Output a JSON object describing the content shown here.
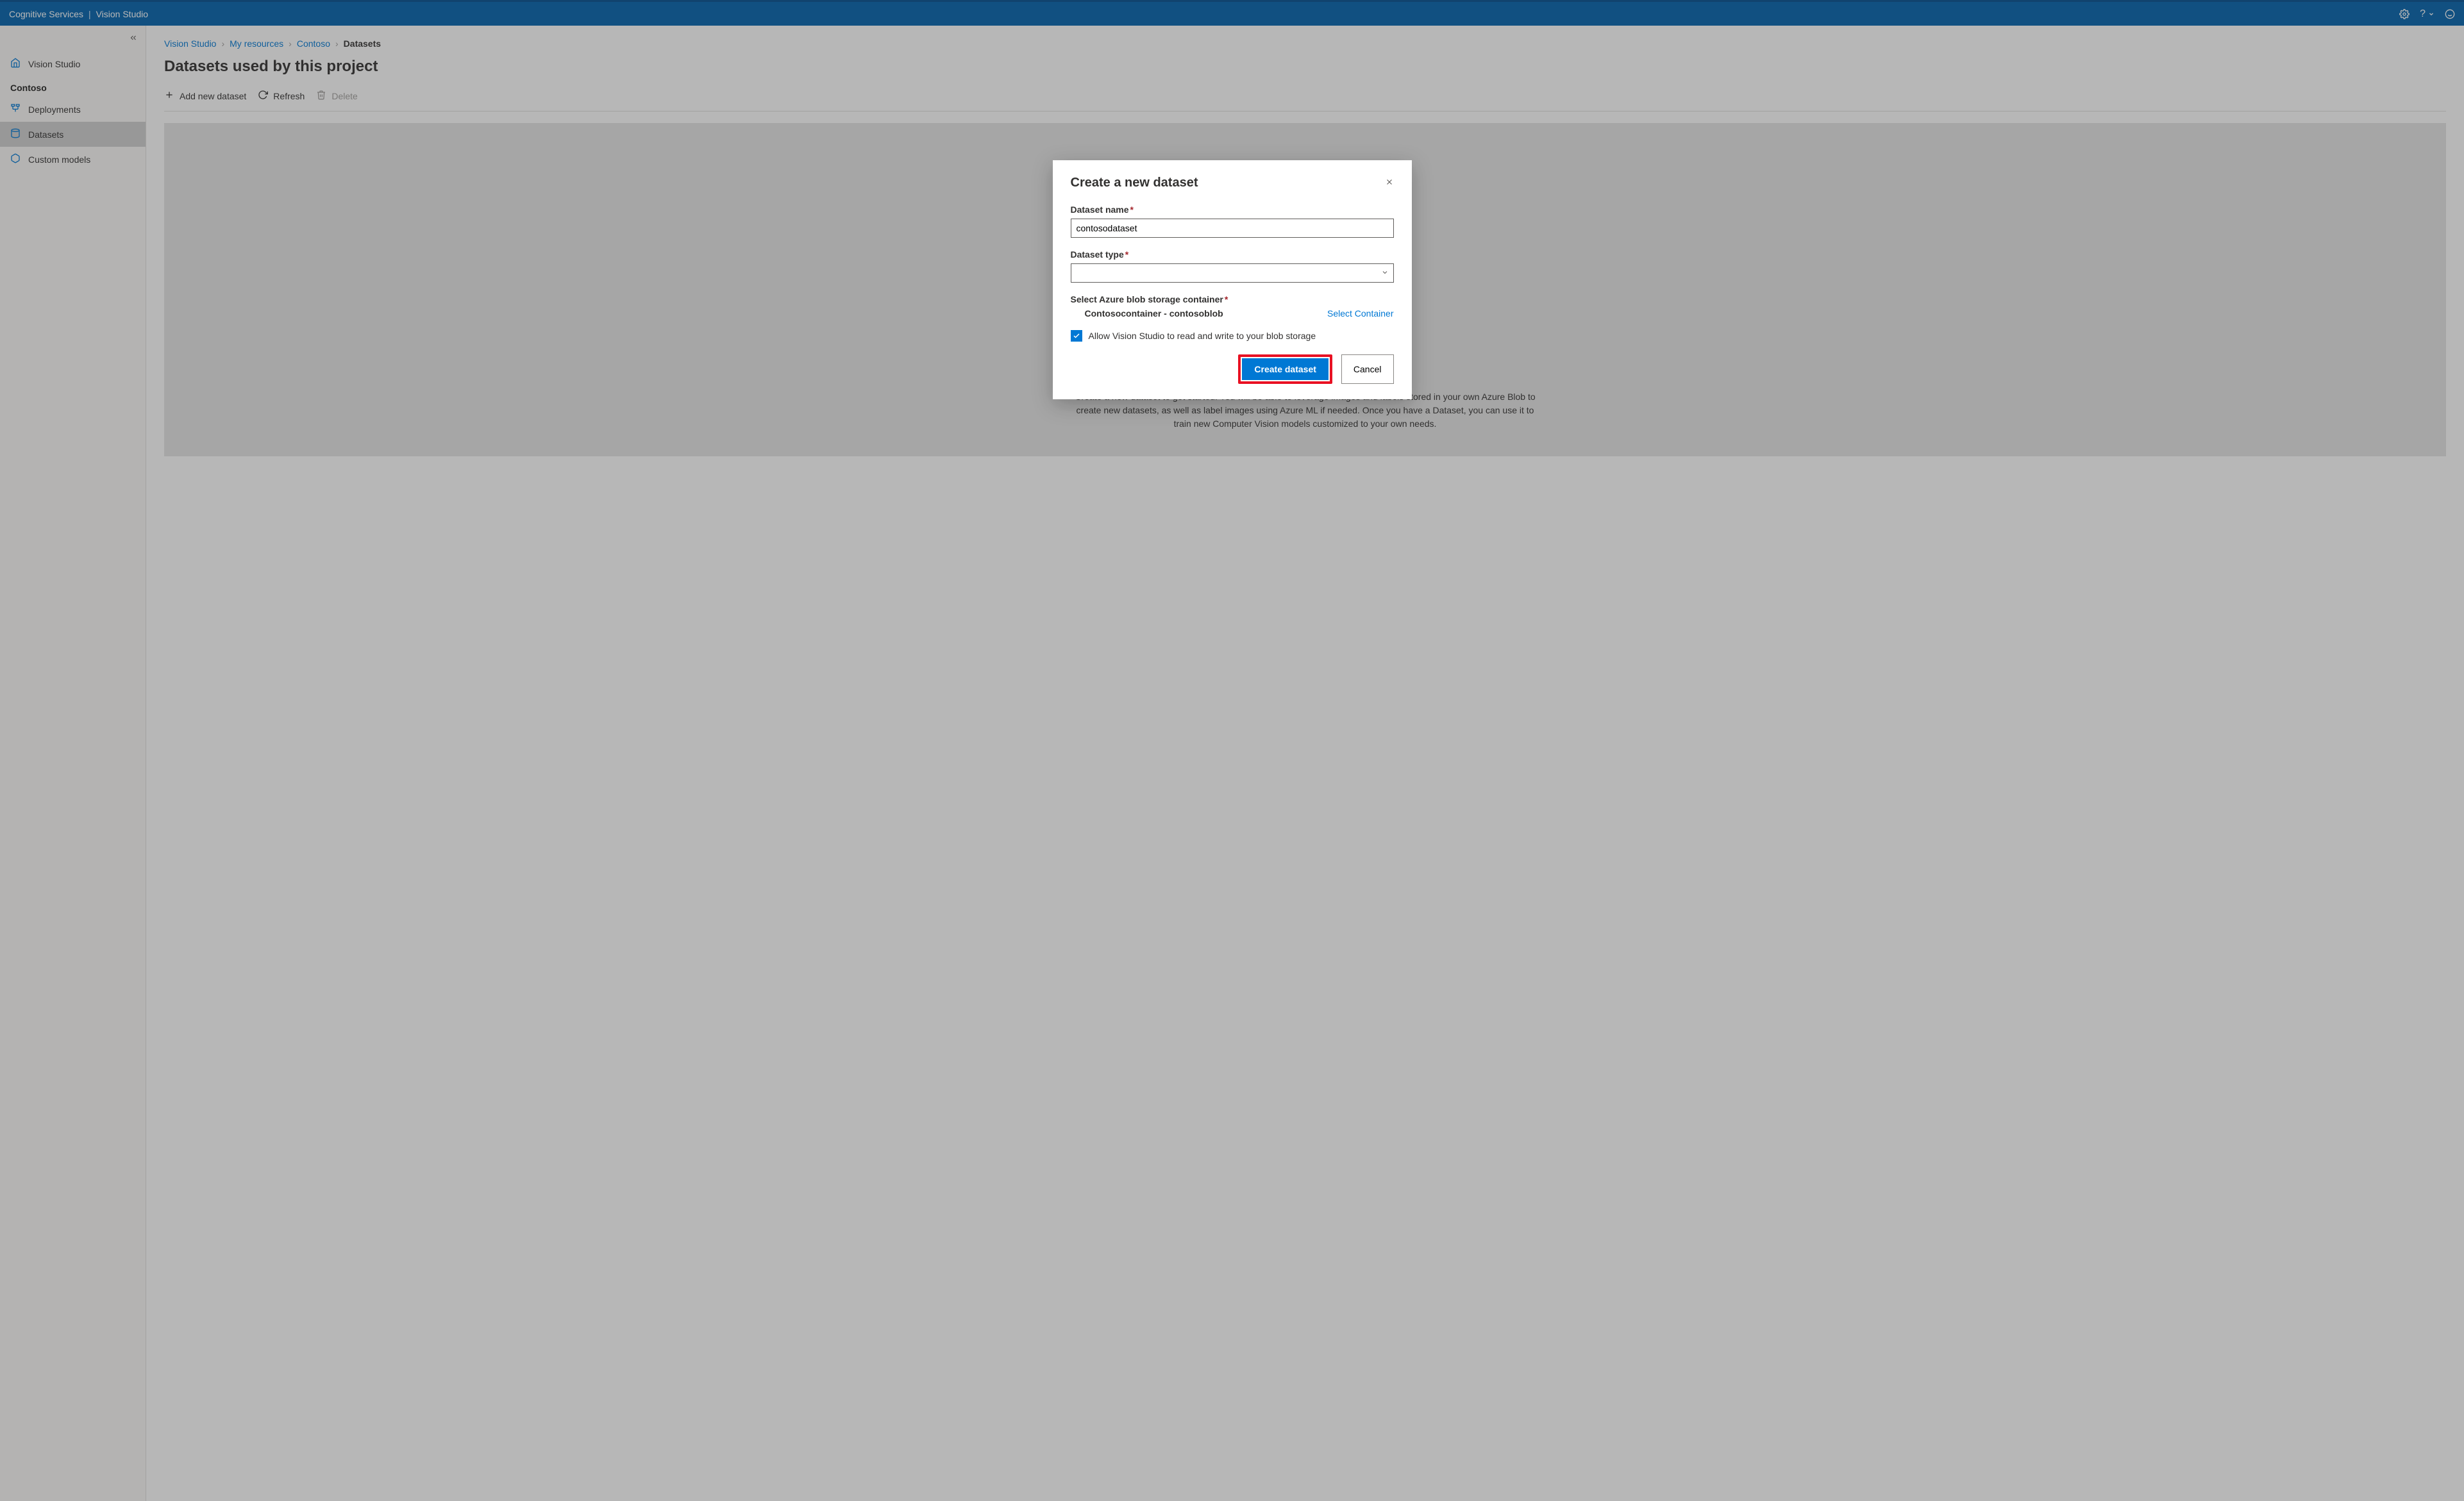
{
  "topbar": {
    "brand": "Cognitive Services",
    "app": "Vision Studio"
  },
  "sidebar": {
    "home_label": "Vision Studio",
    "group_label": "Contoso",
    "items": [
      {
        "label": "Deployments"
      },
      {
        "label": "Datasets"
      },
      {
        "label": "Custom models"
      }
    ]
  },
  "breadcrumb": {
    "items": [
      "Vision Studio",
      "My resources",
      "Contoso",
      "Datasets"
    ]
  },
  "page": {
    "title": "Datasets used by this project",
    "cmd_add": "Add new dataset",
    "cmd_refresh": "Refresh",
    "cmd_delete": "Delete",
    "empty_text": "Create a new dataset to get started. You will be able to leverage images and labels stored in your own Azure Blob to create new datasets, as well as label images using Azure ML if needed. Once you have a Dataset, you can use it to train new Computer Vision models customized to your own needs."
  },
  "modal": {
    "title": "Create a new dataset",
    "name_label": "Dataset name",
    "name_value": "contosodataset",
    "type_label": "Dataset type",
    "type_value": "",
    "container_label": "Select Azure blob storage container",
    "container_name": "Contosocontainer - contosoblob",
    "select_container": "Select Container",
    "allow_read_write": "Allow Vision Studio to read and write to your blob storage",
    "allow_checked": true,
    "create_btn": "Create dataset",
    "cancel_btn": "Cancel"
  }
}
